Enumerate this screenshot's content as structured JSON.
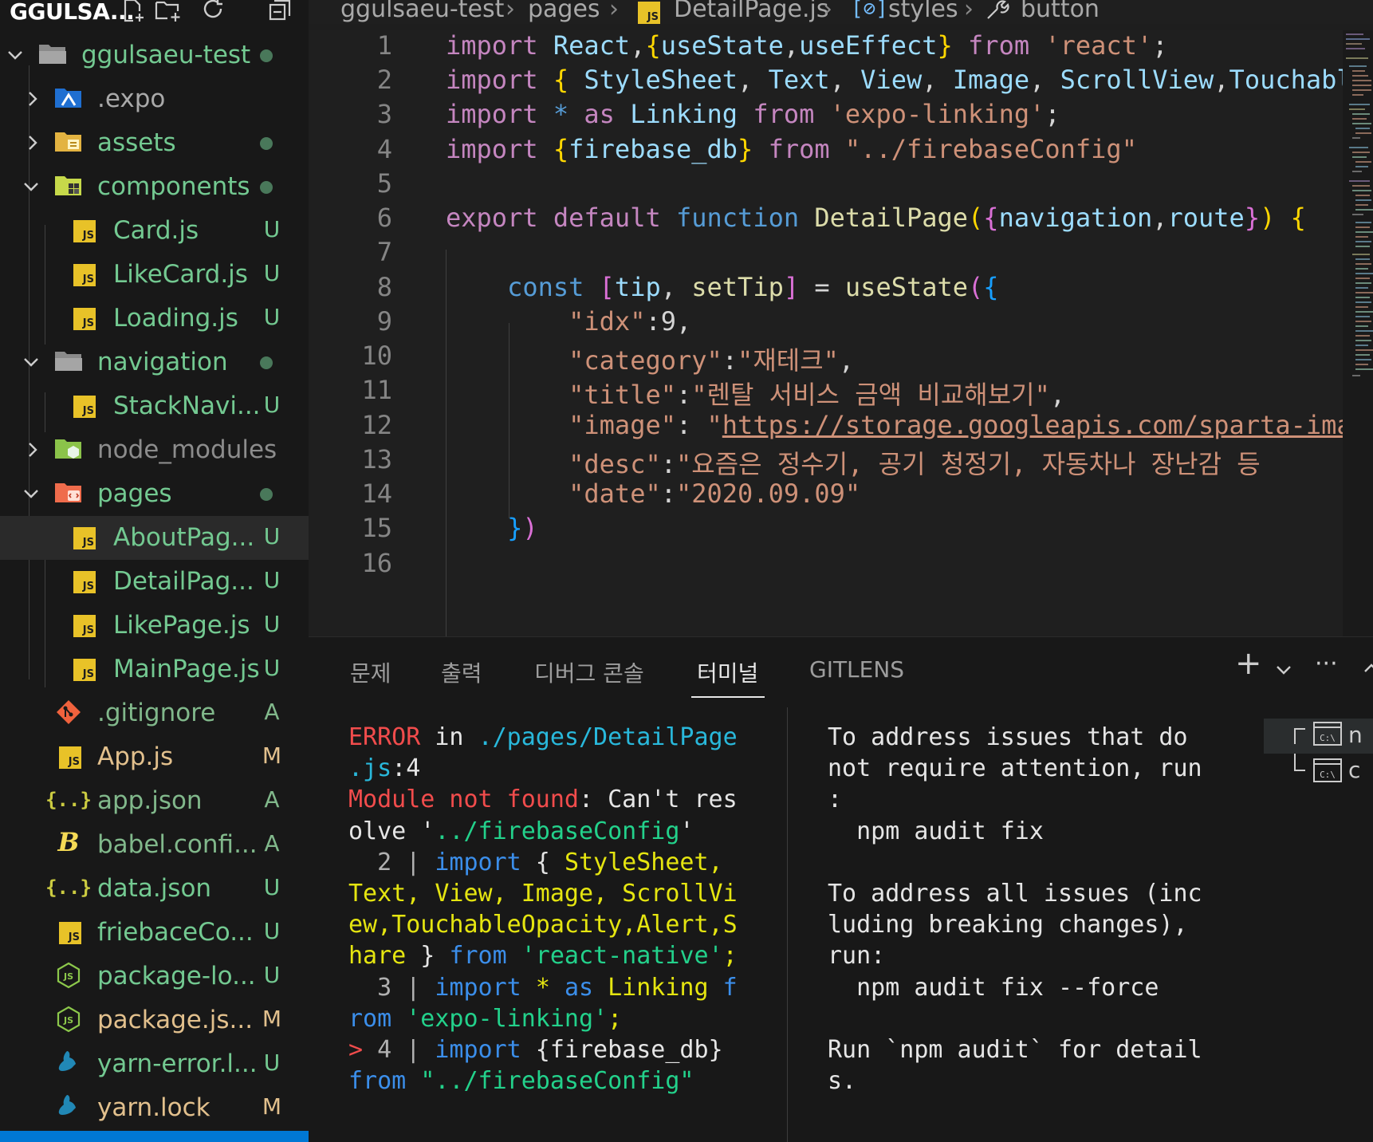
{
  "explorer": {
    "title": "GGULSA...",
    "root": "ggulsaeu-test",
    "items": [
      {
        "label": ".expo"
      },
      {
        "label": "assets"
      },
      {
        "label": "components"
      },
      {
        "label": "Card.js",
        "badge": "U"
      },
      {
        "label": "LikeCard.js",
        "badge": "U"
      },
      {
        "label": "Loading.js",
        "badge": "U"
      },
      {
        "label": "navigation"
      },
      {
        "label": "StackNavi...",
        "badge": "U"
      },
      {
        "label": "node_modules"
      },
      {
        "label": "pages"
      },
      {
        "label": "AboutPag...",
        "badge": "U"
      },
      {
        "label": "DetailPag...",
        "badge": "U"
      },
      {
        "label": "LikePage.js",
        "badge": "U"
      },
      {
        "label": "MainPage.js",
        "badge": "U"
      },
      {
        "label": ".gitignore",
        "badge": "A"
      },
      {
        "label": "App.js",
        "badge": "M"
      },
      {
        "label": "app.json",
        "badge": "A"
      },
      {
        "label": "babel.confi...",
        "badge": "A"
      },
      {
        "label": "data.json",
        "badge": "U"
      },
      {
        "label": "friebaceCo...",
        "badge": "U"
      },
      {
        "label": "package-lo...",
        "badge": "U"
      },
      {
        "label": "package.js...",
        "badge": "M"
      },
      {
        "label": "yarn-error.l...",
        "badge": "U"
      },
      {
        "label": "yarn.lock",
        "badge": "M"
      }
    ]
  },
  "breadcrumb": {
    "project": "ggulsaeu-test",
    "folder": "pages",
    "file": "DetailPage.js",
    "symbol1": "styles",
    "symbol2": "button"
  },
  "editor": {
    "line_numbers": [
      "1",
      "2",
      "3",
      "4",
      "5",
      "6",
      "7",
      "8",
      "9",
      "10",
      "11",
      "12",
      "13",
      "14",
      "15",
      "16"
    ]
  },
  "panel": {
    "tabs": [
      "문제",
      "출력",
      "디버그 콘솔",
      "터미널",
      "GITLENS"
    ],
    "active_tab": "터미널",
    "actions": {
      "add": "+",
      "more": "···"
    },
    "terminals": [
      "n",
      "c"
    ]
  },
  "colors": {
    "sidebar_bg": "#181818",
    "editor_bg": "#1f1f1f",
    "accent": "#0078d4",
    "js_icon": "#e8c228",
    "git_untracked": "#73c991",
    "git_modified": "#e2c08d"
  }
}
